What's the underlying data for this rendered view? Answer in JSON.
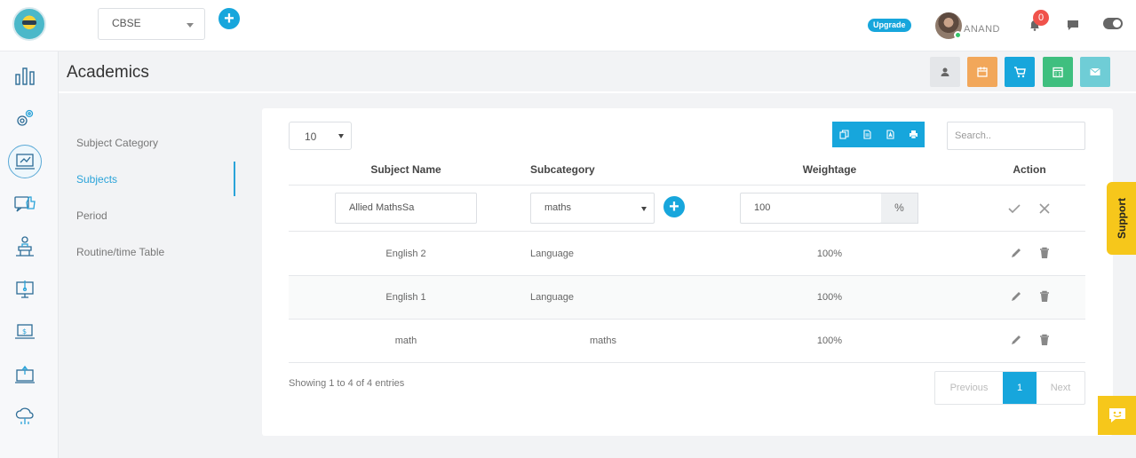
{
  "topbar": {
    "board_select": "CBSE",
    "upgrade_label": "Upgrade",
    "user_name": "ANAND",
    "notification_count": "0",
    "icons": [
      "plus-icon",
      "bell-icon",
      "chat-icon",
      "theme-toggle"
    ]
  },
  "sidebar": {
    "icons": [
      "dashboard-icon",
      "settings-icon",
      "academics-icon",
      "feedback-icon",
      "classroom-icon",
      "online-class-icon",
      "fees-icon",
      "exam-icon",
      "cloud-icon"
    ]
  },
  "page": {
    "title": "Academics",
    "quick_actions": [
      {
        "icon": "user-icon",
        "color": "#e4e6e9"
      },
      {
        "icon": "calendar-icon",
        "color": "#f2a75a"
      },
      {
        "icon": "cart-icon",
        "color": "#17a6dc"
      },
      {
        "icon": "schedule-icon",
        "color": "#3fbf7f"
      },
      {
        "icon": "mail-icon",
        "color": "#6fcdd6"
      }
    ]
  },
  "subnav": {
    "items": [
      {
        "label": "Subject Category"
      },
      {
        "label": "Subjects"
      },
      {
        "label": "Period"
      },
      {
        "label": "Routine/time Table"
      }
    ],
    "active": "Subjects"
  },
  "table": {
    "page_length": "10",
    "search_placeholder": "Search..",
    "export_icons": [
      "copy-icon",
      "csv-icon",
      "pdf-icon",
      "print-icon"
    ],
    "columns": [
      "Subject Name",
      "Subcategory",
      "Weightage",
      "Action"
    ],
    "edit_row": {
      "subject_name": "Allied MathsSa",
      "subcategory": "maths",
      "weightage": "100",
      "unit": "%"
    },
    "rows": [
      {
        "subject": "English 2",
        "subcategory": "Language",
        "weightage": "100%"
      },
      {
        "subject": "English 1",
        "subcategory": "Language",
        "weightage": "100%"
      },
      {
        "subject": "math",
        "subcategory": "maths",
        "weightage": "100%"
      }
    ],
    "info": "Showing 1 to 4 of 4 entries",
    "pagination": {
      "previous": "Previous",
      "current": "1",
      "next": "Next"
    }
  },
  "support_label": "Support",
  "colors": {
    "accent": "#17a6dc",
    "support": "#f6c71b",
    "badge": "#f0524b"
  }
}
